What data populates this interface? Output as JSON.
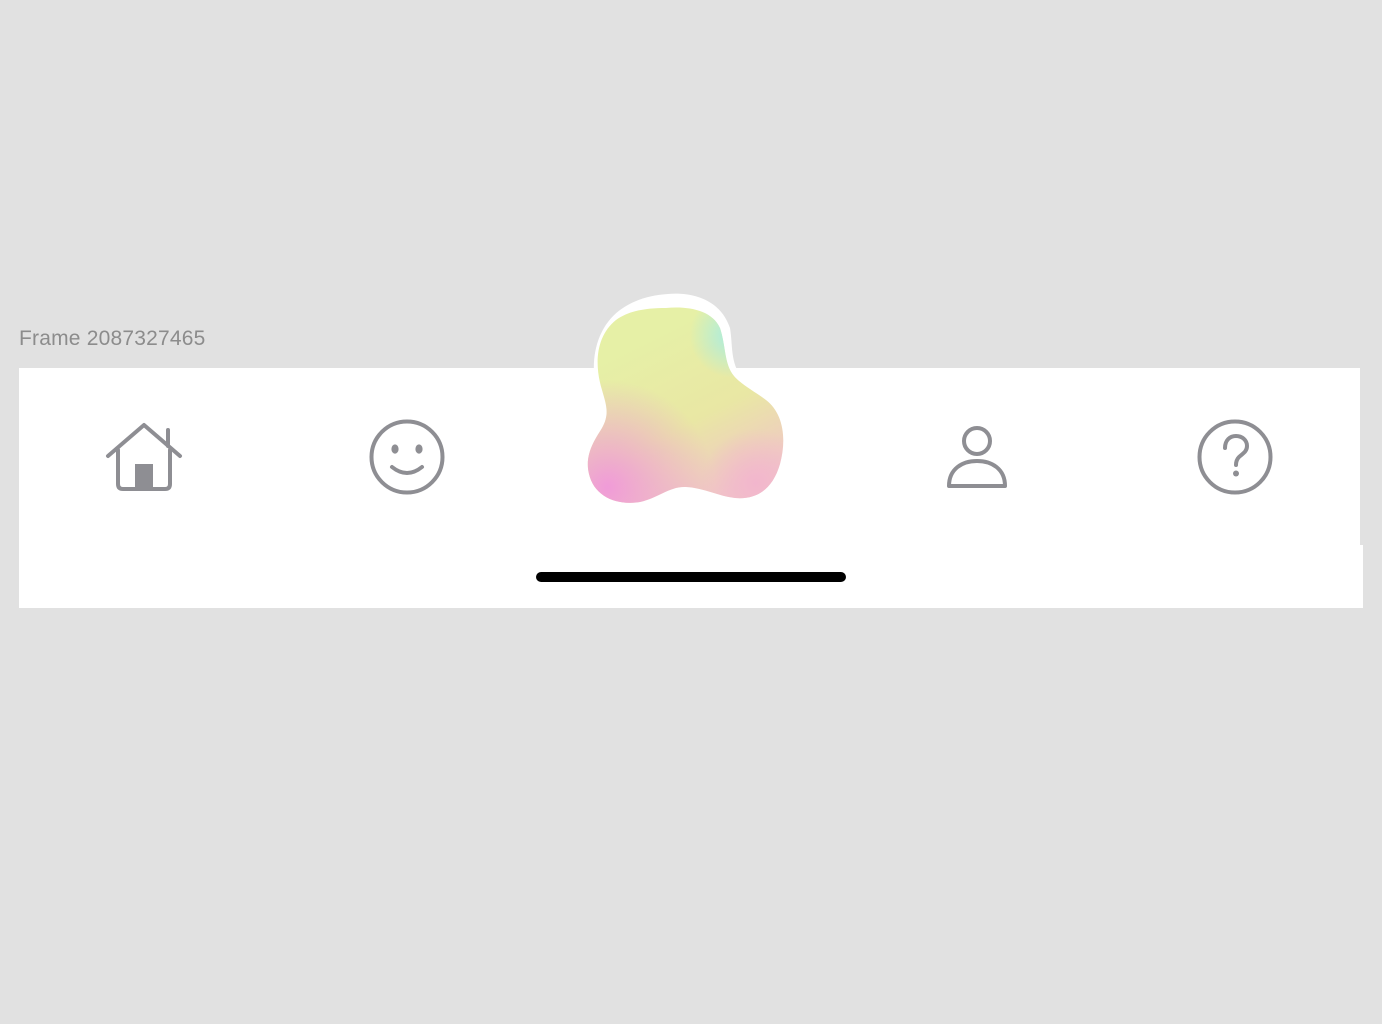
{
  "canvas": {
    "frame_label": "Frame 2087327465"
  },
  "tab_bar": {
    "items": [
      {
        "icon": "home-icon",
        "color": "#8e8e93"
      },
      {
        "icon": "smiley-icon",
        "color": "#8e8e93"
      },
      {
        "icon": "gradient-blob-icon",
        "colors": [
          "#f09bd8",
          "#e7f0a2",
          "#a7ede3"
        ]
      },
      {
        "icon": "person-icon",
        "color": "#8e8e93"
      },
      {
        "icon": "help-icon",
        "color": "#8e8e93"
      }
    ]
  },
  "home_indicator": {
    "color": "#000000"
  }
}
